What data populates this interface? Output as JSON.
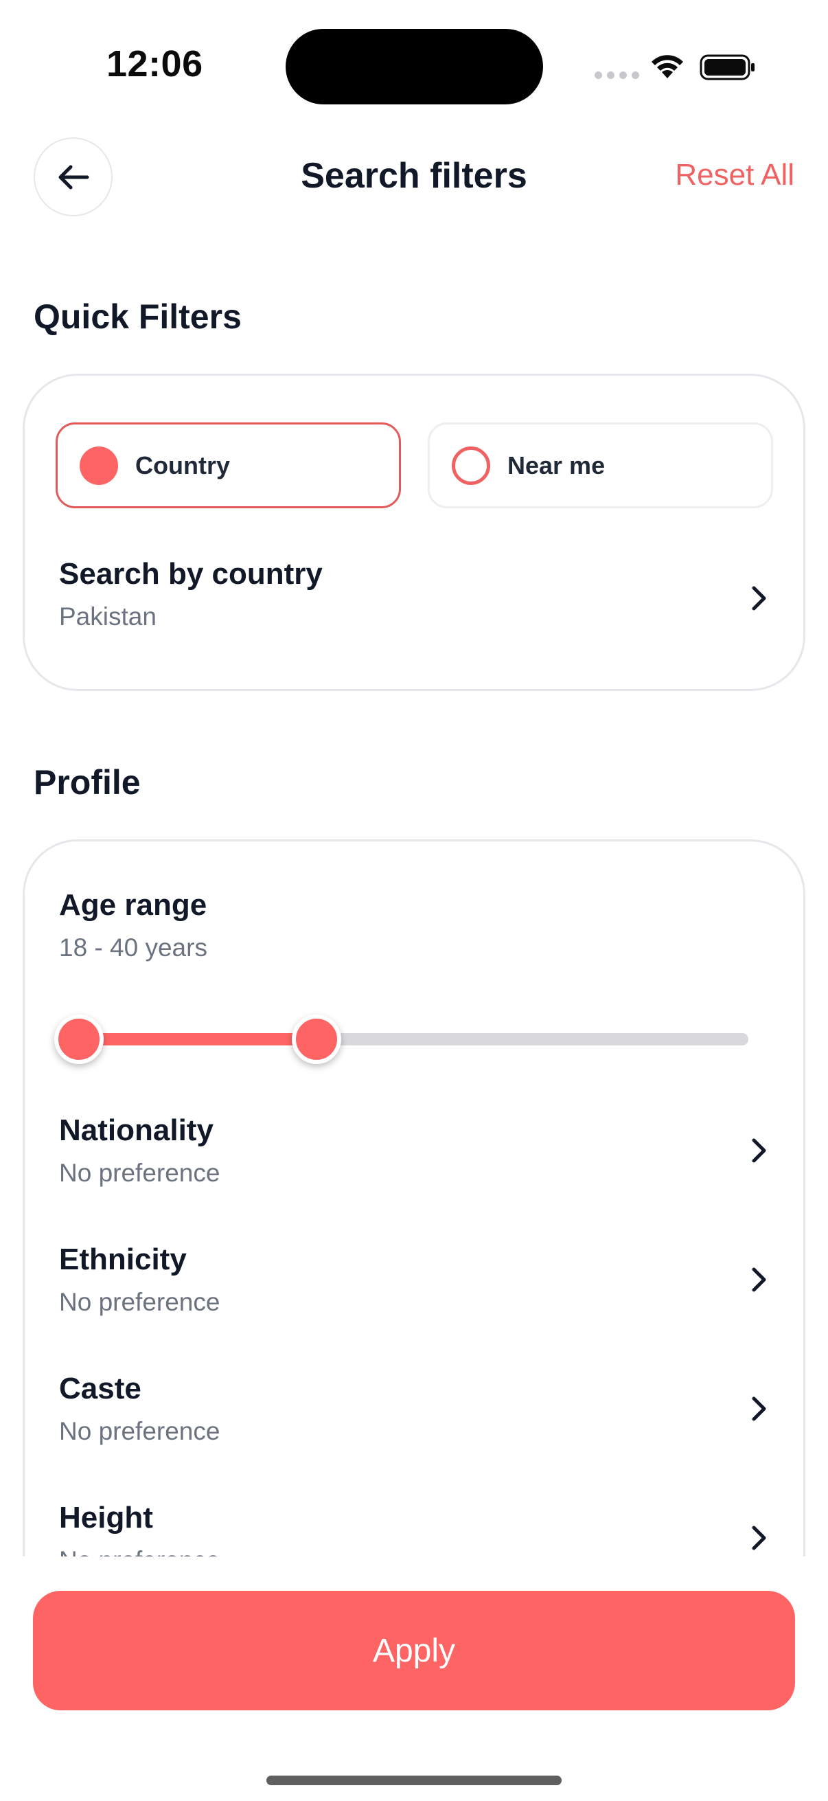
{
  "status_bar": {
    "time": "12:06"
  },
  "header": {
    "title": "Search filters",
    "reset_label": "Reset All",
    "back_icon": "arrow-left-icon"
  },
  "quick_filters": {
    "section_title": "Quick Filters",
    "options": [
      {
        "label": "Country",
        "selected": true
      },
      {
        "label": "Near me",
        "selected": false
      }
    ],
    "search_by_country": {
      "title": "Search by country",
      "value": "Pakistan"
    }
  },
  "profile": {
    "section_title": "Profile",
    "age_range": {
      "title": "Age range",
      "value_text": "18 - 40 years",
      "min": 18,
      "max": 40
    },
    "rows": [
      {
        "title": "Nationality",
        "value": "No preference"
      },
      {
        "title": "Ethnicity",
        "value": "No preference"
      },
      {
        "title": "Caste",
        "value": "No preference"
      },
      {
        "title": "Height",
        "value": "No preference"
      }
    ]
  },
  "footer": {
    "apply_label": "Apply"
  },
  "colors": {
    "accent": "#ff6464",
    "accent_text": "#f06262",
    "text_primary": "#111827",
    "text_secondary": "#6b7280",
    "border": "#e5e7eb"
  }
}
